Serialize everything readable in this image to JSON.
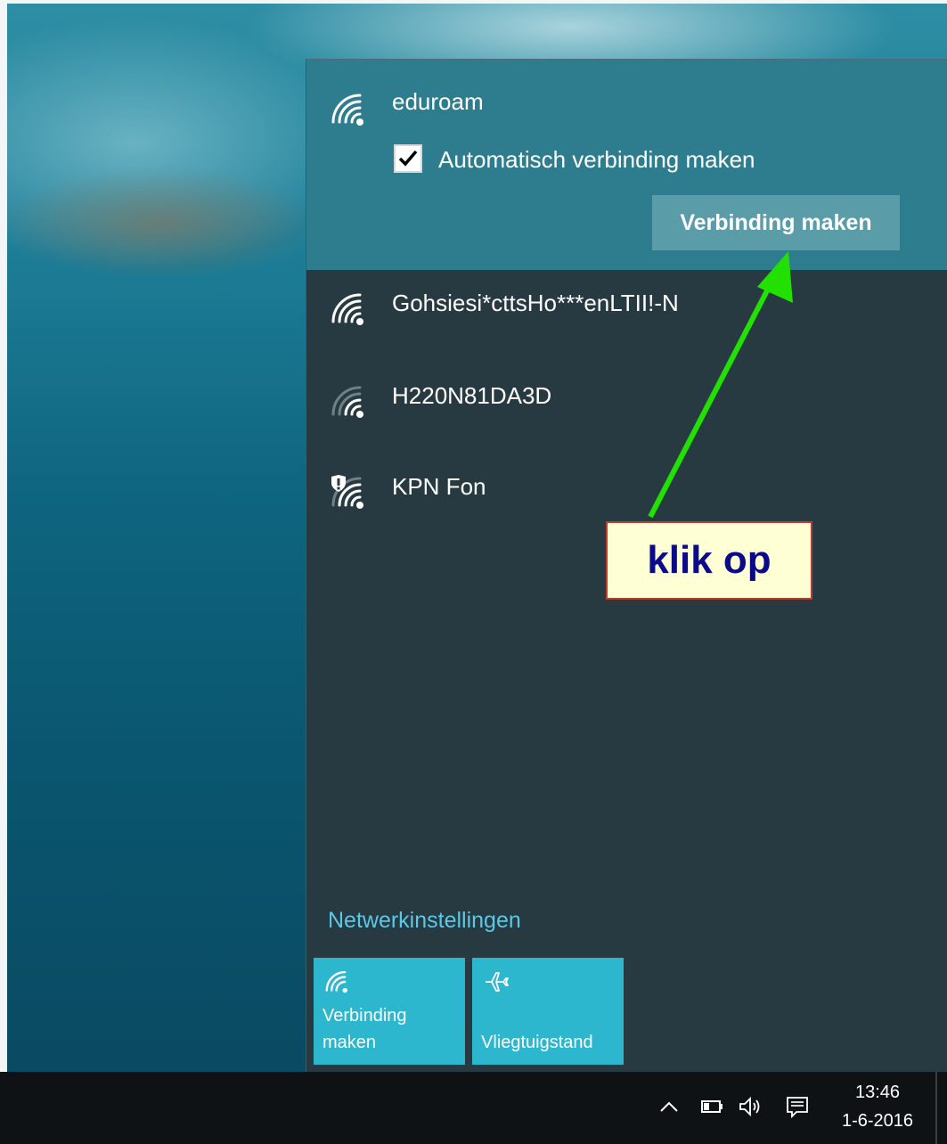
{
  "selected_network": {
    "name": "eduroam",
    "auto_connect_label": "Automatisch verbinding maken",
    "auto_connect_checked": true,
    "connect_button": "Verbinding maken"
  },
  "networks": [
    {
      "name": "Gohsiesi*cttsHo***enLTII!-N",
      "icon": "wifi-signal-icon"
    },
    {
      "name": "H220N81DA3D",
      "icon": "wifi-signal-weak-icon"
    },
    {
      "name": "KPN Fon",
      "icon": "wifi-shield-icon"
    }
  ],
  "network_settings_link": "Netwerkinstellingen",
  "quick_tiles": [
    {
      "label": "Verbinding maken",
      "label_line1": "Verbinding",
      "label_line2": "maken",
      "icon": "wifi-icon"
    },
    {
      "label": "Vliegtuigstand",
      "icon": "airplane-icon"
    }
  ],
  "taskbar": {
    "time": "13:46",
    "date": "1-6-2016",
    "tray_icons": [
      "chevron-up-icon",
      "battery-icon",
      "volume-icon",
      "notification-icon"
    ]
  },
  "annotation": {
    "callout_text": "klik op",
    "callout_border": "#c0392b",
    "arrow_color": "#22e000"
  },
  "colors": {
    "flyout_bg": "#273a42",
    "selected_bg": "#2e7d8e",
    "link": "#5ac8e6",
    "tile_bg": "#2db7cf"
  }
}
